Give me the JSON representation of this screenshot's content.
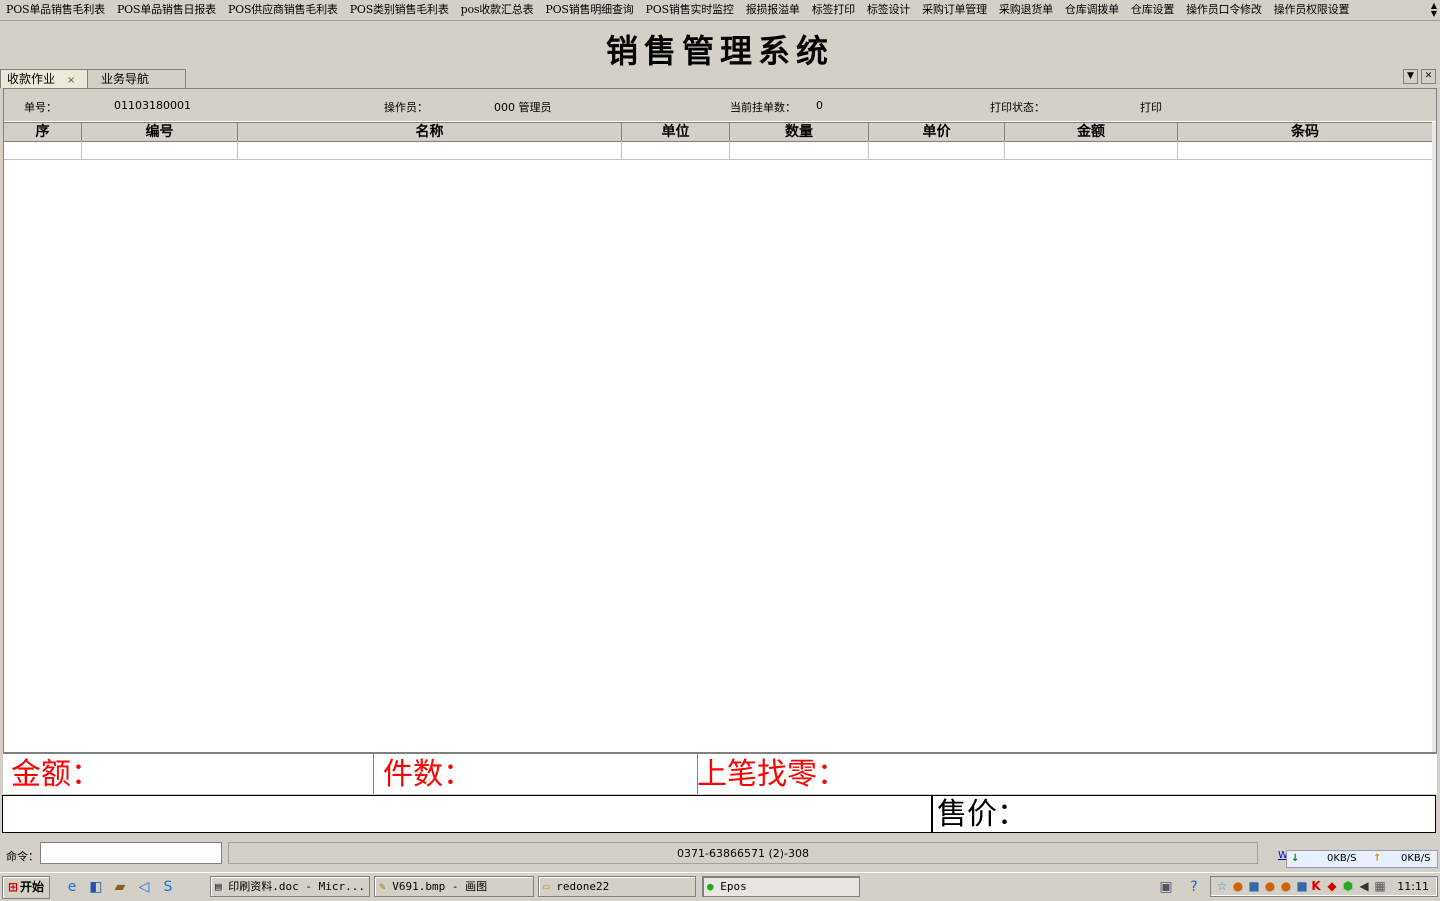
{
  "menu": {
    "items": [
      "POS单品销售毛利表",
      "POS单品销售日报表",
      "POS供应商销售毛利表",
      "POS类别销售毛利表",
      "pos收款汇总表",
      "POS销售明细查询",
      "POS销售实时监控",
      "报损报溢单",
      "标签打印",
      "标签设计",
      "采购订单管理",
      "采购退货单",
      "仓库调拨单",
      "仓库设置",
      "操作员口令修改",
      "操作员权限设置"
    ]
  },
  "title": "销售管理系统",
  "tabs": [
    {
      "label": "收款作业",
      "close": "×"
    },
    {
      "label": "业务导航"
    }
  ],
  "tab_controls": {
    "dropdown": "▼",
    "close": "✕"
  },
  "info": {
    "order_no_label": "单号：",
    "order_no": "01103180001",
    "operator_label": "操作员：",
    "operator": "000 管理员",
    "hold_count_label": "当前挂单数：",
    "hold_count": "0",
    "print_status_label": "打印状态：",
    "print_status": "打印"
  },
  "grid": {
    "columns": [
      "序",
      "编号",
      "名称",
      "单位",
      "数量",
      "单价",
      "金额",
      "条码"
    ]
  },
  "totals": {
    "amount_label": "金额：",
    "count_label": "件数：",
    "change_label": "上笔找零："
  },
  "input": {
    "price_label": "售价："
  },
  "statusbar": {
    "cmd_label": "命令：",
    "center_text": "0371-63866571 (2)-308",
    "w_link": "W",
    "down_icon": "↓",
    "down_speed": "0KB/S",
    "up_icon": "↑",
    "up_speed": "0KB/S"
  },
  "taskbar": {
    "start_label": "开始",
    "tasks": [
      "印刷资料.doc - Micr...",
      "V691.bmp - 画图",
      "redone22",
      "Epos"
    ],
    "clock": "11:11"
  }
}
